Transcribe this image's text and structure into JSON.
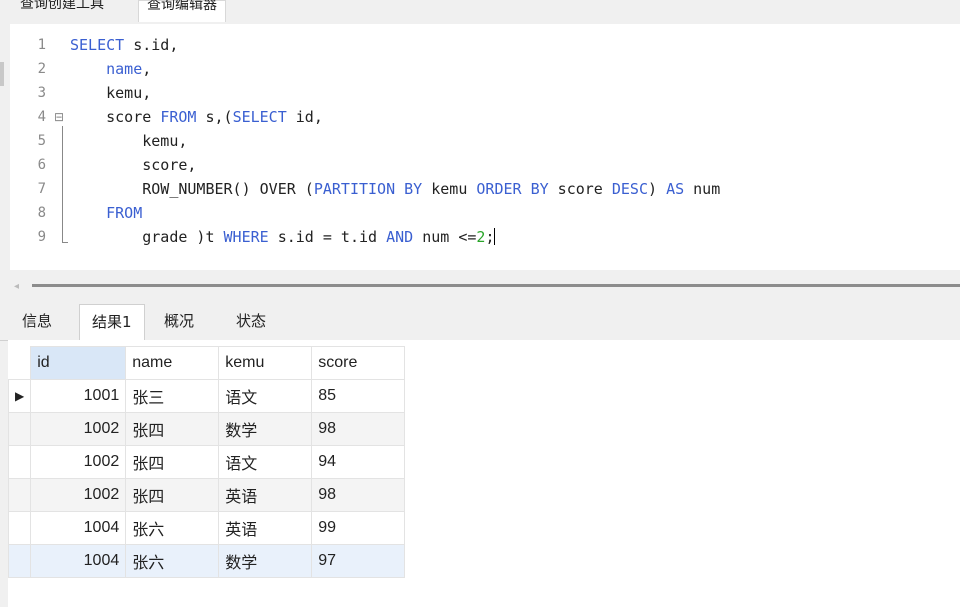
{
  "top_tabs": [
    "查询创建工具",
    "查询编辑器"
  ],
  "editor": {
    "lines": [
      {
        "num": "1"
      },
      {
        "num": "2"
      },
      {
        "num": "3"
      },
      {
        "num": "4"
      },
      {
        "num": "5"
      },
      {
        "num": "6"
      },
      {
        "num": "7"
      },
      {
        "num": "8"
      },
      {
        "num": "9"
      }
    ],
    "code": {
      "l1_kw": "SELECT",
      "l1_rest": " s.id,",
      "l2_kw": "name",
      "l2_rest": ",",
      "l3": "kemu,",
      "l4_a": "score ",
      "l4_from": "FROM",
      "l4_b": " s,(",
      "l4_select": "SELECT",
      "l4_c": " id,",
      "l5": "kemu,",
      "l6": "score,",
      "l7_a": "ROW_NUMBER() OVER (",
      "l7_partition": "PARTITION BY",
      "l7_b": " kemu ",
      "l7_order": "ORDER BY",
      "l7_c": " score ",
      "l7_desc": "DESC",
      "l7_d": ") ",
      "l7_as": "AS",
      "l7_e": " num",
      "l8_kw": "FROM",
      "l9_a": "grade )t ",
      "l9_where": "WHERE",
      "l9_b": " s.id = t.id ",
      "l9_and": "AND",
      "l9_c": " num <=",
      "l9_num": "2",
      "l9_d": ";"
    }
  },
  "result_tabs": [
    "信息",
    "结果1",
    "概况",
    "状态"
  ],
  "table": {
    "headers": [
      "id",
      "name",
      "kemu",
      "score"
    ],
    "rows": [
      {
        "id": "1001",
        "name": "张三",
        "kemu": "语文",
        "score": "85"
      },
      {
        "id": "1002",
        "name": "张四",
        "kemu": "数学",
        "score": "98"
      },
      {
        "id": "1002",
        "name": "张四",
        "kemu": "语文",
        "score": "94"
      },
      {
        "id": "1002",
        "name": "张四",
        "kemu": "英语",
        "score": "98"
      },
      {
        "id": "1004",
        "name": "张六",
        "kemu": "英语",
        "score": "99"
      },
      {
        "id": "1004",
        "name": "张六",
        "kemu": "数学",
        "score": "97"
      }
    ]
  },
  "colors": {
    "keyword": "#3a5fd1",
    "number": "#2aa52a",
    "selected_header": "#d9e7f7"
  }
}
